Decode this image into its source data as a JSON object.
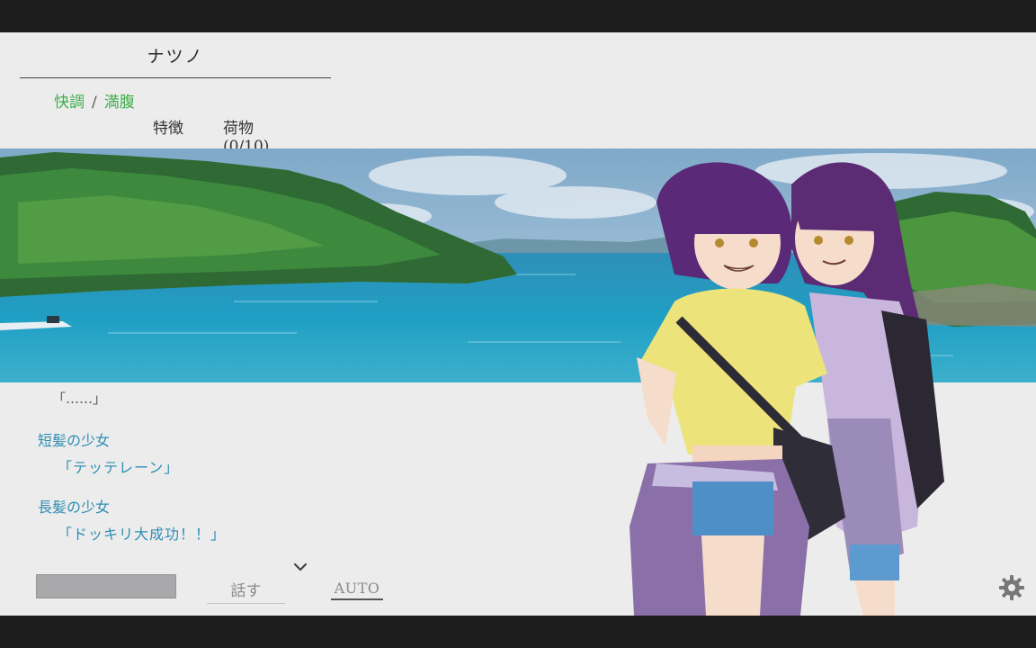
{
  "header": {
    "character_name": "ナツノ",
    "status_good": "快調",
    "status_separator": "/",
    "status_food": "満腹"
  },
  "tabs": {
    "traits": "特徴",
    "cargo": "荷物 (0/10)"
  },
  "dialogue": {
    "cut_line": "「……」",
    "entries": [
      {
        "speaker": "短髪の少女",
        "text": "「テッテレーン」"
      },
      {
        "speaker": "長髪の少女",
        "text": "「ドッキリ大成功！！」"
      }
    ]
  },
  "controls": {
    "talk_label": "話す",
    "auto_label": "AUTO"
  },
  "icons": {
    "scroll_down": "chevron-down-icon",
    "settings": "gear-icon"
  },
  "colors": {
    "status_green": "#3fae4c",
    "dialogue_blue": "#2e8fb4",
    "panel_bg": "#ececec",
    "letterbox": "#1d1d1d"
  }
}
